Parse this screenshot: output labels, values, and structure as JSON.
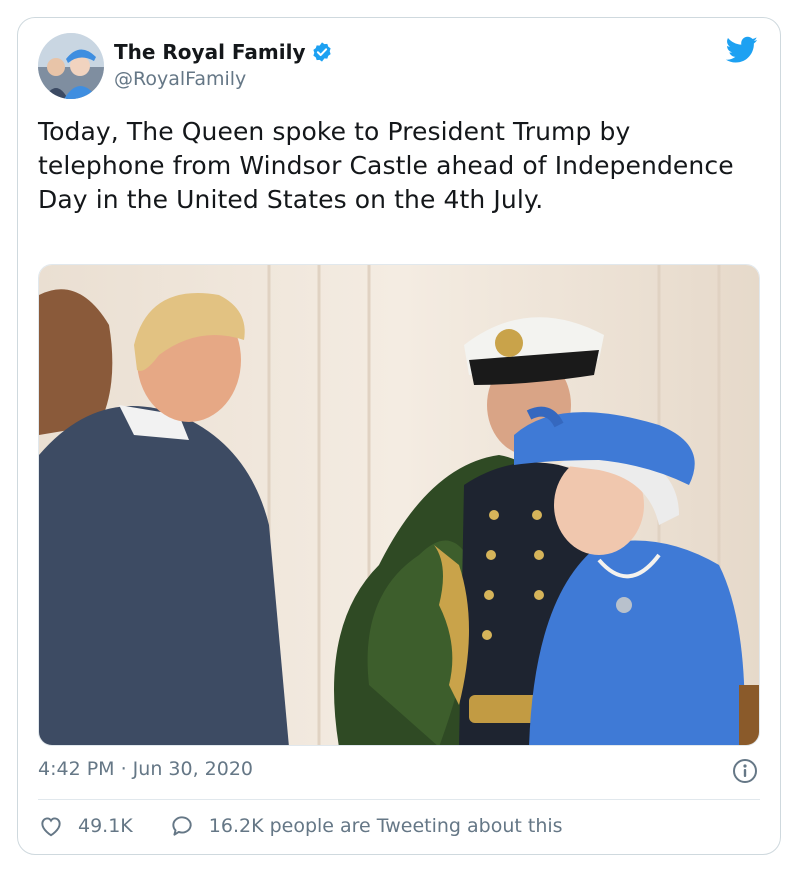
{
  "tweet": {
    "author": {
      "display_name": "The Royal Family",
      "handle": "@RoyalFamily",
      "verified": true
    },
    "text": "Today, The Queen spoke to President Trump by telephone from Windsor Castle ahead of Independence Day in the United States on the 4th July.",
    "timestamp": "4:42 PM · Jun 30, 2020",
    "likes": "49.1K",
    "conversation": "16.2K people are Tweeting about this"
  },
  "colors": {
    "brand": "#1da1f2",
    "text_primary": "#14171a",
    "text_secondary": "#657786",
    "border": "#cfd9de"
  },
  "icons": {
    "brand": "twitter-bird-icon",
    "verified": "verified-badge-icon",
    "info": "info-icon",
    "like": "heart-icon",
    "reply": "speech-bubble-icon"
  }
}
